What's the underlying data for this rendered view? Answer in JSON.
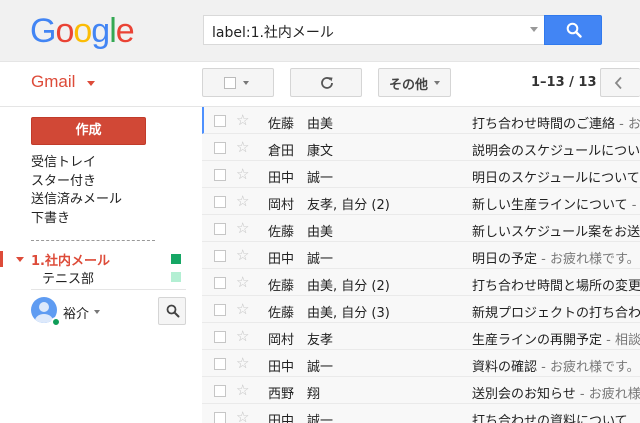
{
  "header": {
    "logo_text": [
      "G",
      "o",
      "o",
      "g",
      "l",
      "e"
    ],
    "logo_colors": [
      "#4285f4",
      "#ea4335",
      "#fbbc05",
      "#4285f4",
      "#34a853",
      "#ea4335"
    ],
    "search_value": "label:1.社内メール"
  },
  "toolbar": {
    "app_label": "Gmail",
    "more_label": "その他",
    "page_count": "1–13 / 13"
  },
  "sidebar": {
    "compose_label": "作成",
    "nav_items": [
      "受信トレイ",
      "スター付き",
      "送信済みメール",
      "下書き"
    ],
    "active_label": "1.社内メール",
    "sub_label": "テニス部",
    "label_colors": [
      "#16a765",
      "#b3efd3"
    ],
    "user_name": "裕介"
  },
  "mails": [
    {
      "sender": "佐藤　由美",
      "subject": "打ち合わせ時間のご連絡",
      "snippet": " - お疲れ様です。"
    },
    {
      "sender": "倉田　康文",
      "subject": "説明会のスケジュールについ",
      "snippet": ""
    },
    {
      "sender": "田中　誠一",
      "subject": "明日のスケジュールについて",
      "snippet": ""
    },
    {
      "sender": "岡村　友孝, 自分 (2)",
      "subject": "新しい生産ラインについて",
      "snippet": " - お疲れ様です。"
    },
    {
      "sender": "佐藤　由美",
      "subject": "新しいスケジュール案をお送",
      "snippet": ""
    },
    {
      "sender": "田中　誠一",
      "subject": "明日の予定",
      "snippet": " - お疲れ様です。"
    },
    {
      "sender": "佐藤　由美, 自分 (2)",
      "subject": "打ち合わせ時間と場所の変更",
      "snippet": ""
    },
    {
      "sender": "佐藤　由美, 自分 (3)",
      "subject": "新規プロジェクトの打ち合わせ",
      "snippet": ""
    },
    {
      "sender": "岡村　友孝",
      "subject": "生産ラインの再開予定",
      "snippet": " - 相談"
    },
    {
      "sender": "田中　誠一",
      "subject": "資料の確認",
      "snippet": " - お疲れ様です。"
    },
    {
      "sender": "西野　翔",
      "subject": "送別会のお知らせ",
      "snippet": " - お疲れ様です。"
    },
    {
      "sender": "田中　誠一",
      "subject": "打ち合わせの資料について",
      "snippet": ""
    }
  ]
}
